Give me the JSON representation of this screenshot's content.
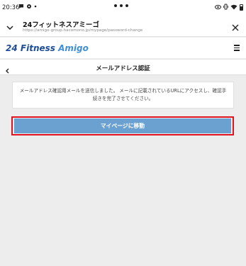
{
  "status_bar": {
    "time": "20:36",
    "left_icons": [
      "chat-icon",
      "settings-icon",
      "dot"
    ],
    "right_icons": [
      "eye-icon",
      "vibrate-icon",
      "wifi-icon",
      "battery-icon"
    ]
  },
  "browser": {
    "title": "24フィットネスアミーゴ",
    "url": "https://amigo-group.hacomono.jp/mypage/password-change",
    "close_icon": "close-icon",
    "chevron_icon": "chevron-down-icon"
  },
  "site_header": {
    "logo_number": "24",
    "logo_fitness": "Fitness",
    "logo_amigo": "Amigo",
    "menu_icon": "hamburger-icon"
  },
  "page": {
    "title": "メールアドレス認証",
    "back_icon": "chevron-left-icon",
    "message": "メールアドレス確認用メールを送信しました。 メールに記載されているURLにアクセスし、確認手続きを完了させてください。",
    "mypage_button_label": "マイページに移動"
  },
  "colors": {
    "background": "#ededed",
    "button": "#6aa1d0",
    "highlight_outline": "#e0141e",
    "logo_dark_blue": "#1f4e96",
    "logo_light_blue": "#3f8fd6"
  }
}
